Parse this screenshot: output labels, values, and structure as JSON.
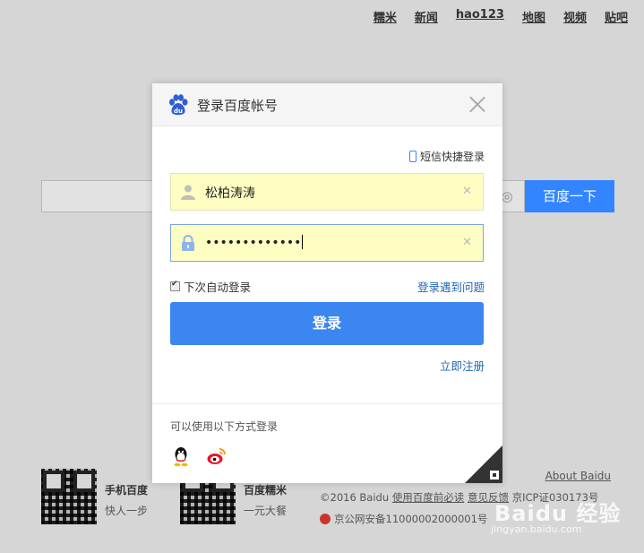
{
  "top_nav": [
    "糯米",
    "新闻",
    "hao123",
    "地图",
    "视频",
    "贴吧"
  ],
  "search": {
    "button_label": "百度一下",
    "value": ""
  },
  "footer": {
    "promos": [
      {
        "title": "手机百度",
        "subtitle": "快人一步"
      },
      {
        "title": "百度糯米",
        "subtitle": "一元大餐"
      }
    ],
    "about": "About Baidu",
    "copyright_prefix": "©2016 Baidu ",
    "copyright_link1": "使用百度前必读",
    "copyright_link2": "意见反馈",
    "copyright_suffix": " 京ICP证030173号",
    "police": "京公网安备11000002000001号",
    "watermark_main": "Baidu 经验",
    "watermark_sub": "jingyan.baidu.com"
  },
  "modal": {
    "title": "登录百度帐号",
    "sms_login": "短信快捷登录",
    "username": "松柏涛涛",
    "password_mask": "•••••••••••••",
    "clear_glyph": "✕",
    "remember_label": "下次自动登录",
    "remember_checked": true,
    "problem_link": "登录遇到问题",
    "login_button": "登录",
    "register_link": "立即注册",
    "other_methods_label": "可以使用以下方式登录",
    "accent_color": "#3b86f0"
  }
}
